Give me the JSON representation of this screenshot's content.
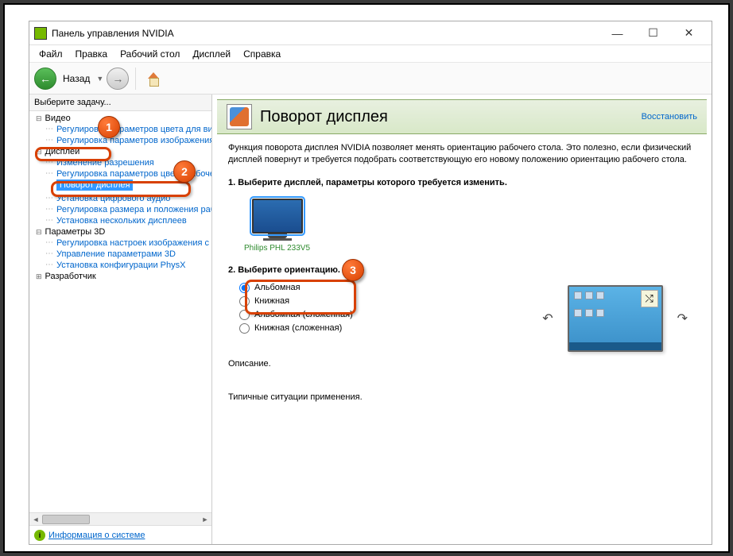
{
  "window": {
    "title": "Панель управления NVIDIA"
  },
  "menu": {
    "file": "Файл",
    "edit": "Правка",
    "desktop": "Рабочий стол",
    "display": "Дисплей",
    "help": "Справка"
  },
  "toolbar": {
    "back": "Назад"
  },
  "sidebar": {
    "title": "Выберите задачу...",
    "groups": {
      "video": "Видео",
      "display": "Дисплей",
      "params3d": "Параметры 3D",
      "dev": "Разработчик"
    },
    "items": {
      "video_color": "Регулировка параметров цвета для вид",
      "video_image": "Регулировка параметров изображения д",
      "resolution": "Изменение разрешения",
      "desktop_color": "Регулировка параметров цвета рабочег",
      "rotate": "Поворот дисплея",
      "digital_audio": "Установка цифрового аудио",
      "size_pos": "Регулировка размера и положения рабо",
      "multi": "Установка нескольких дисплеев",
      "img3d": "Регулировка настроек изображения с пр",
      "manage3d": "Управление параметрами 3D",
      "physx": "Установка конфигурации PhysX"
    }
  },
  "footer": {
    "sysinfo": "Информация о системе"
  },
  "content": {
    "title": "Поворот дисплея",
    "restore": "Восстановить",
    "description": "Функция поворота дисплея NVIDIA позволяет менять ориентацию рабочего стола. Это полезно, если физический дисплей повернут и требуется подобрать соответствующую его новому положению ориентацию рабочего стола.",
    "step1": "1. Выберите дисплей, параметры которого требуется изменить.",
    "monitor_label": "Philips PHL 233V5",
    "step2": "2. Выберите ориентацию.",
    "orientations": {
      "landscape": "Альбомная",
      "portrait": "Книжная",
      "landscape_flip": "Альбомная (сложенная)",
      "portrait_flip": "Книжная (сложенная)"
    },
    "desc_label": "Описание.",
    "typical_label": "Типичные ситуации применения."
  },
  "markers": {
    "m1": "1",
    "m2": "2",
    "m3": "3"
  }
}
